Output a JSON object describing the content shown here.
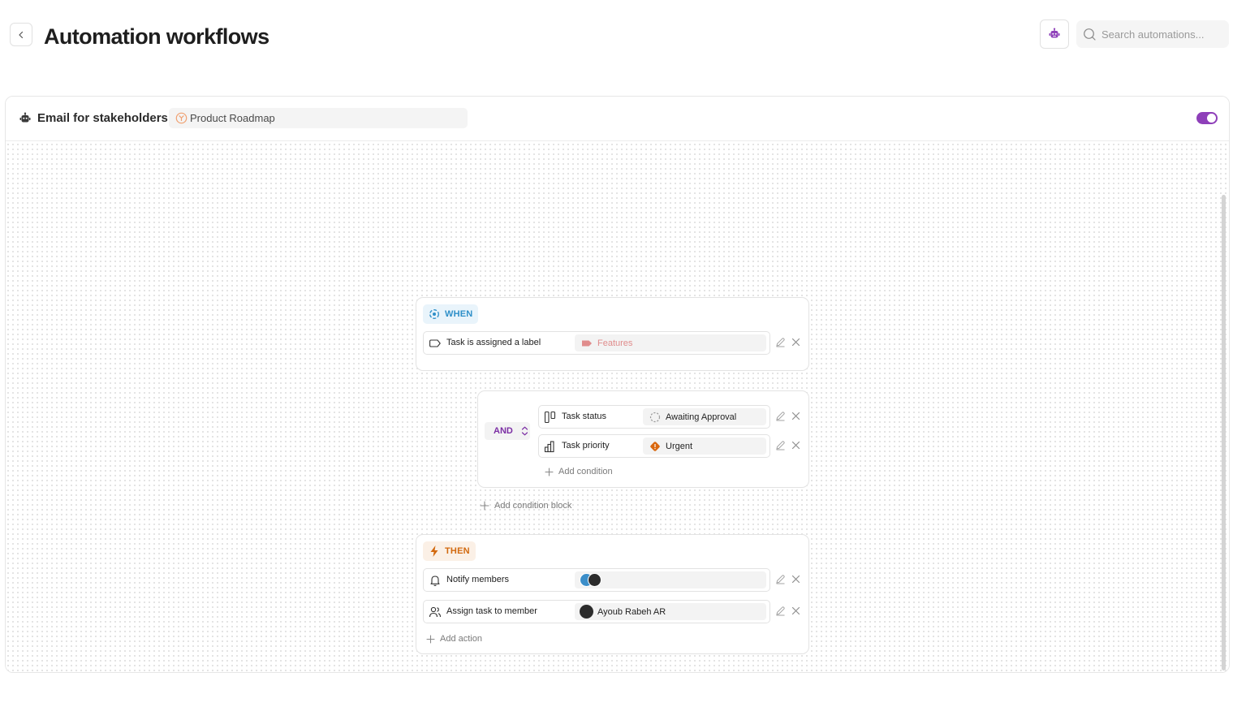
{
  "header": {
    "title": "Automation workflows",
    "search_placeholder": "Search automations..."
  },
  "workflow": {
    "name": "Email for stakeholders",
    "project": "Product Roadmap",
    "enabled": true
  },
  "when_block": {
    "tag": "WHEN",
    "trigger": {
      "label": "Task is assigned a label",
      "value": "Features",
      "value_color": "#e08c8c"
    }
  },
  "condition_block": {
    "operator": "AND",
    "conditions": [
      {
        "label": "Task status",
        "value": "Awaiting Approval"
      },
      {
        "label": "Task priority",
        "value": "Urgent"
      }
    ],
    "add_condition_label": "Add condition"
  },
  "add_condition_block_label": "Add condition block",
  "then_block": {
    "tag": "THEN",
    "actions": [
      {
        "label": "Notify members",
        "value": ""
      },
      {
        "label": "Assign task to member",
        "value": "Ayoub Rabeh AR"
      }
    ],
    "add_action_label": "Add action"
  },
  "colors": {
    "accent": "#8e3fb9",
    "when": "#2e8fc8",
    "then": "#d2690e",
    "urgent": "#d9680f",
    "label_features": "#e08c8c"
  }
}
